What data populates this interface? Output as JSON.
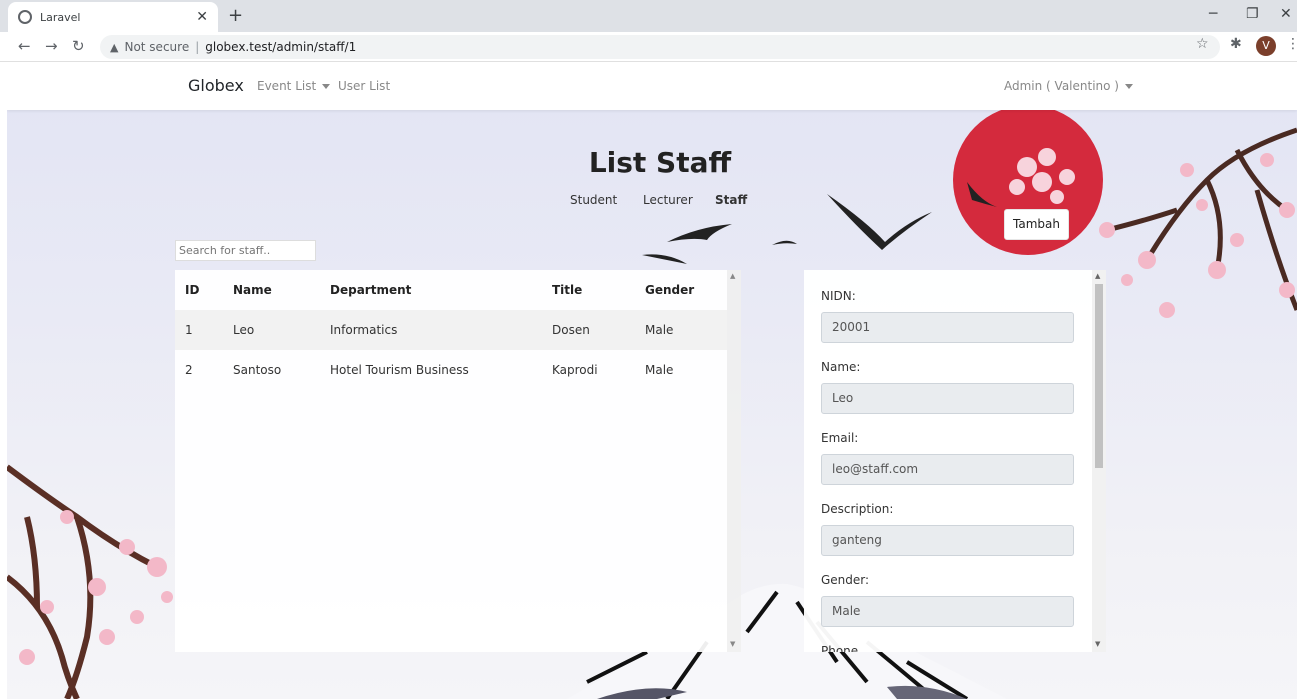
{
  "browser": {
    "tab_title": "Laravel",
    "tab_close": "✕",
    "new_tab": "+",
    "security_label": "Not secure",
    "url": "globex.test/admin/staff/1",
    "profile_initial": "V",
    "icons": [
      "back-icon",
      "forward-icon",
      "reload-icon",
      "star-icon",
      "extensions-icon",
      "menu-icon"
    ]
  },
  "navbar": {
    "brand": "Globex",
    "event_list": "Event List",
    "user_list": "User List",
    "admin": "Admin ( Valentino )"
  },
  "page": {
    "title": "List Staff",
    "subnav": [
      "Student",
      "Lecturer",
      "Staff"
    ],
    "active_subnav": "Staff",
    "add_button": "Tambah",
    "search_placeholder": "Search for staff.."
  },
  "table": {
    "headers": [
      "ID",
      "Name",
      "Department",
      "Title",
      "Gender"
    ],
    "rows": [
      {
        "id": "1",
        "name": "Leo",
        "department": "Informatics",
        "title": "Dosen",
        "gender": "Male"
      },
      {
        "id": "2",
        "name": "Santoso",
        "department": "Hotel Tourism Business",
        "title": "Kaprodi",
        "gender": "Male"
      }
    ]
  },
  "detail": {
    "nidn_label": "NIDN:",
    "nidn": "20001",
    "name_label": "Name:",
    "name": "Leo",
    "email_label": "Email:",
    "email": "leo@staff.com",
    "description_label": "Description:",
    "description": "ganteng",
    "gender_label": "Gender:",
    "gender": "Male",
    "phone_label": "Phone"
  },
  "colors": {
    "sun": "#d42a3d",
    "link": "#3490dc"
  }
}
